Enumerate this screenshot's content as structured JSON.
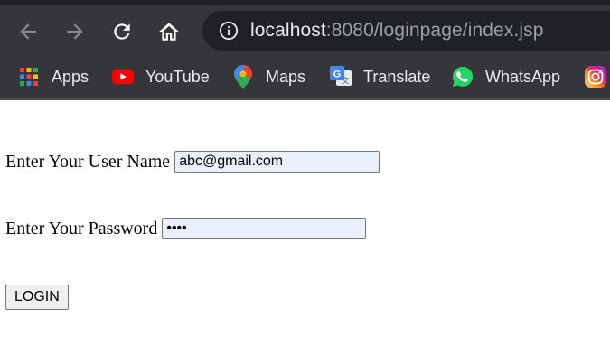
{
  "browser": {
    "url_host": "localhost",
    "url_rest": ":8080/loginpage/index.jsp",
    "bookmarks": [
      {
        "label": "Apps",
        "icon": "apps-grid-icon"
      },
      {
        "label": "YouTube",
        "icon": "youtube-icon"
      },
      {
        "label": "Maps",
        "icon": "maps-pin-icon"
      },
      {
        "label": "Translate",
        "icon": "translate-icon"
      },
      {
        "label": "WhatsApp",
        "icon": "whatsapp-icon"
      },
      {
        "label": "",
        "icon": "instagram-icon"
      }
    ]
  },
  "form": {
    "username_label": "Enter Your User Name",
    "username_value": "abc@gmail.com",
    "password_label": "Enter Your Password",
    "password_value": "abcd",
    "login_label": "LOGIN"
  }
}
